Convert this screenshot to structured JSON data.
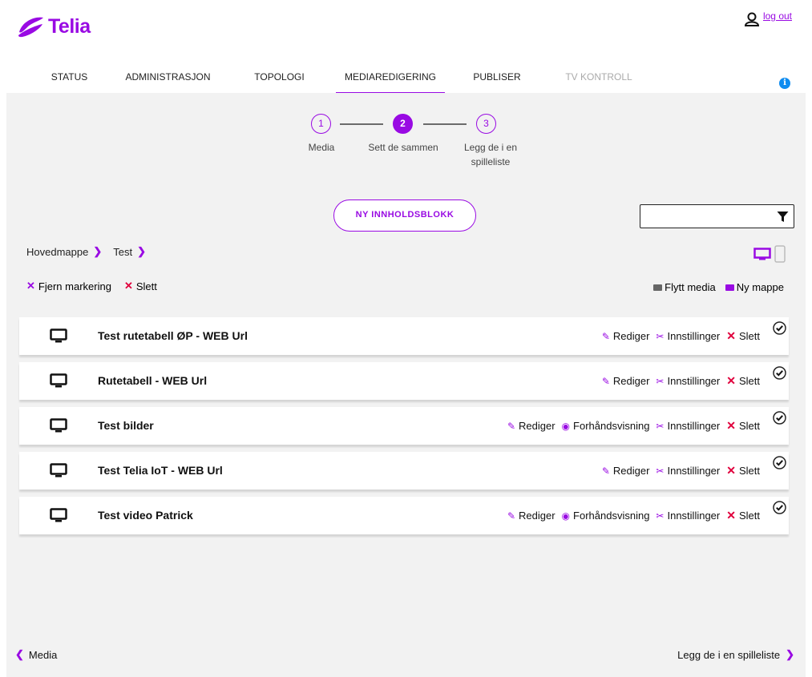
{
  "brand": {
    "name": "Telia",
    "color": "#990ae3"
  },
  "user": {
    "icon": "user-icon",
    "logout_label": "log out"
  },
  "nav": {
    "items": [
      {
        "label": "STATUS",
        "state": "normal"
      },
      {
        "label": "ADMINISTRASJON",
        "state": "normal"
      },
      {
        "label": "TOPOLOGI",
        "state": "normal"
      },
      {
        "label": "MEDIAREDIGERING",
        "state": "active"
      },
      {
        "label": "PUBLISER",
        "state": "normal"
      },
      {
        "label": "TV KONTROLL",
        "state": "disabled"
      }
    ],
    "info_icon": "i"
  },
  "stepper": {
    "steps": [
      {
        "number": "1",
        "label": "Media"
      },
      {
        "number": "2",
        "label": "Sett de sammen"
      },
      {
        "number": "3",
        "label_line1": "Legg de i en",
        "label_line2": "spilleliste"
      }
    ],
    "active_step": 2
  },
  "toolbar": {
    "new_block_label": "NY INNHOLDSBLOKK",
    "filter_value": ""
  },
  "breadcrumb": [
    "Hovedmappe",
    "Test"
  ],
  "selection_actions": {
    "clear_label": "Fjern markering",
    "delete_label": "Slett"
  },
  "folder_actions": {
    "move_label": "Flytt media",
    "new_folder_label": "Ny mappe"
  },
  "rows": [
    {
      "title": "Test rutetabell ØP - WEB Url",
      "edit": "Rediger",
      "settings": "Innstillinger",
      "delete": "Slett",
      "preview": ""
    },
    {
      "title": "Rutetabell - WEB Url",
      "edit": "Rediger",
      "settings": "Innstillinger",
      "delete": "Slett",
      "preview": ""
    },
    {
      "title": "Test bilder",
      "edit": "Rediger",
      "preview": "Forhåndsvisning",
      "settings": "Innstillinger",
      "delete": "Slett"
    },
    {
      "title": "Test Telia IoT - WEB Url",
      "edit": "Rediger",
      "settings": "Innstillinger",
      "delete": "Slett",
      "preview": ""
    },
    {
      "title": "Test video Patrick",
      "edit": "Rediger",
      "preview": "Forhåndsvisning",
      "settings": "Innstillinger",
      "delete": "Slett"
    }
  ],
  "bottom_nav": {
    "prev_label": "Media",
    "next_label": "Legg de i en spilleliste"
  }
}
